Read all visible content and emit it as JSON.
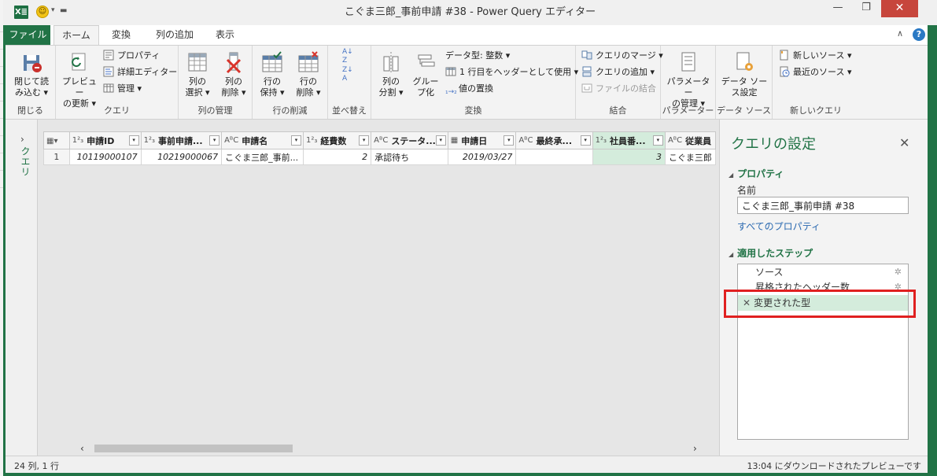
{
  "window": {
    "title": "こぐま三郎_事前申請 #38 - Power Query エディター",
    "app_badge": "X≣",
    "minimize_glyph": "—",
    "maximize_glyph": "❐",
    "close_glyph": "✕"
  },
  "ribbon_tabs": {
    "file": "ファイル",
    "home": "ホーム",
    "transform": "変換",
    "add_column": "列の追加",
    "view": "表示"
  },
  "ribbon": {
    "close_group": {
      "label": "閉じる",
      "close_load_1": "閉じて読",
      "close_load_2": "み込む ▾"
    },
    "query_group": {
      "label": "クエリ",
      "refresh_1": "プレビュー",
      "refresh_2": "の更新 ▾",
      "properties": "プロパティ",
      "advanced_editor": "詳細エディター",
      "manage": "管理 ▾"
    },
    "column_mgmt_group": {
      "label": "列の管理",
      "choose_1": "列の",
      "choose_2": "選択 ▾",
      "remove_1": "列の",
      "remove_2": "削除 ▾"
    },
    "row_reduce_group": {
      "label": "行の削減",
      "keep_1": "行の",
      "keep_2": "保持 ▾",
      "remove_1": "行の",
      "remove_2": "削除 ▾"
    },
    "sort_group": {
      "label": "並べ替え"
    },
    "transform_group": {
      "label": "変換",
      "split_1": "列の",
      "split_2": "分割 ▾",
      "group_1": "グルー",
      "group_2": "プ化",
      "data_type": "データ型: 整数 ▾",
      "first_row_header": "1 行目をヘッダーとして使用 ▾",
      "replace_values": "値の置換"
    },
    "combine_group": {
      "label": "結合",
      "merge": "クエリのマージ ▾",
      "append": "クエリの追加 ▾",
      "combine_files": "ファイルの結合"
    },
    "parameters_group": {
      "label": "パラメーター",
      "manage_1": "パラメーター",
      "manage_2": "の管理 ▾"
    },
    "datasource_group": {
      "label": "データ ソース",
      "settings_1": "データ ソー",
      "settings_2": "ス設定"
    },
    "newquery_group": {
      "label": "新しいクエリ",
      "new_source": "新しいソース ▾",
      "recent_sources": "最近のソース ▾"
    }
  },
  "query_pane": {
    "label": "クエリ",
    "chevron": "›"
  },
  "grid": {
    "columns": [
      {
        "type": "1²₃",
        "name": "申請ID"
      },
      {
        "type": "1²₃",
        "name": "事前申請..."
      },
      {
        "type": "AᴮC",
        "name": "申請名"
      },
      {
        "type": "1²₃",
        "name": "経費数"
      },
      {
        "type": "AᴮC",
        "name": "ステータ..."
      },
      {
        "type": "▦",
        "name": "申請日"
      },
      {
        "type": "AᴮC",
        "name": "最終承..."
      },
      {
        "type": "1²₃",
        "name": "社員番..."
      },
      {
        "type": "AᴮC",
        "name": "従業員"
      }
    ],
    "rows": [
      {
        "index": "1",
        "cells": [
          "10119000107",
          "10219000067",
          "こぐま三郎_事前...",
          "2",
          "承認待ち",
          "2019/03/27",
          "",
          "3",
          "こぐま三郎"
        ]
      }
    ]
  },
  "settings": {
    "title": "クエリの設定",
    "close_glyph": "✕",
    "properties_header": "プロパティ",
    "name_label": "名前",
    "name_value": "こぐま三郎_事前申請 #38",
    "all_properties": "すべてのプロパティ",
    "steps_header": "適用したステップ",
    "steps": [
      "ソース",
      "昇格されたヘッダー数",
      "変更された型"
    ],
    "gear_glyph": "✲",
    "delete_glyph": "✕"
  },
  "status": {
    "left": "24 列, 1 行",
    "right": "13:04 にダウンロードされたプレビューです"
  },
  "colors": {
    "accent": "#217346",
    "highlight": "#e02020",
    "selected": "#d4ecdc"
  }
}
